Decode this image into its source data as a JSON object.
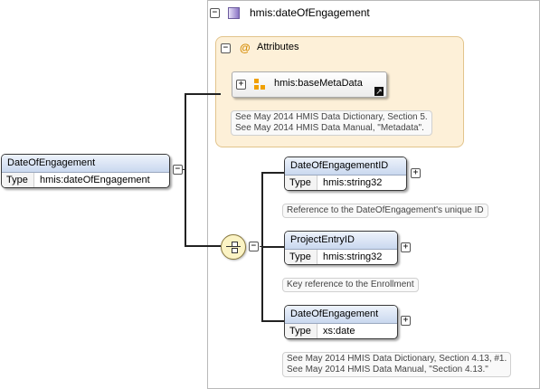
{
  "type_header": {
    "label": "hmis:dateOfEngagement"
  },
  "attributes": {
    "label": "Attributes",
    "at_symbol": "@",
    "attr_ref": {
      "label": "hmis:baseMetaData"
    },
    "note_lines": [
      "See May 2014 HMIS Data Dictionary, Section 5.",
      "See May 2014 HMIS Data Manual, \"Metadata\"."
    ]
  },
  "root_element": {
    "name": "DateOfEngagement",
    "type_key": "Type",
    "type_value": "hmis:dateOfEngagement"
  },
  "children": [
    {
      "name": "DateOfEngagementID",
      "type_key": "Type",
      "type_value": "hmis:string32",
      "note_lines": [
        "Reference to the DateOfEngagement's unique ID"
      ]
    },
    {
      "name": "ProjectEntryID",
      "type_key": "Type",
      "type_value": "hmis:string32",
      "note_lines": [
        "Key reference to the Enrollment"
      ]
    },
    {
      "name": "DateOfEngagement",
      "type_key": "Type",
      "type_value": "xs:date",
      "note_lines": [
        "See May 2014 HMIS Data Dictionary, Section 4.13, #1.",
        "See May 2014 HMIS Data Manual, \"Section 4.13.\""
      ]
    }
  ],
  "icons": {
    "collapse": "collapse-minus-icon",
    "expand": "expand-plus-icon",
    "sequence": "sequence-compositor-icon",
    "complex_type": "complex-type-icon",
    "attribute_group": "attribute-group-icon",
    "link": "link-arrow-icon"
  },
  "symbols": {
    "minus": "−",
    "plus": "+"
  }
}
